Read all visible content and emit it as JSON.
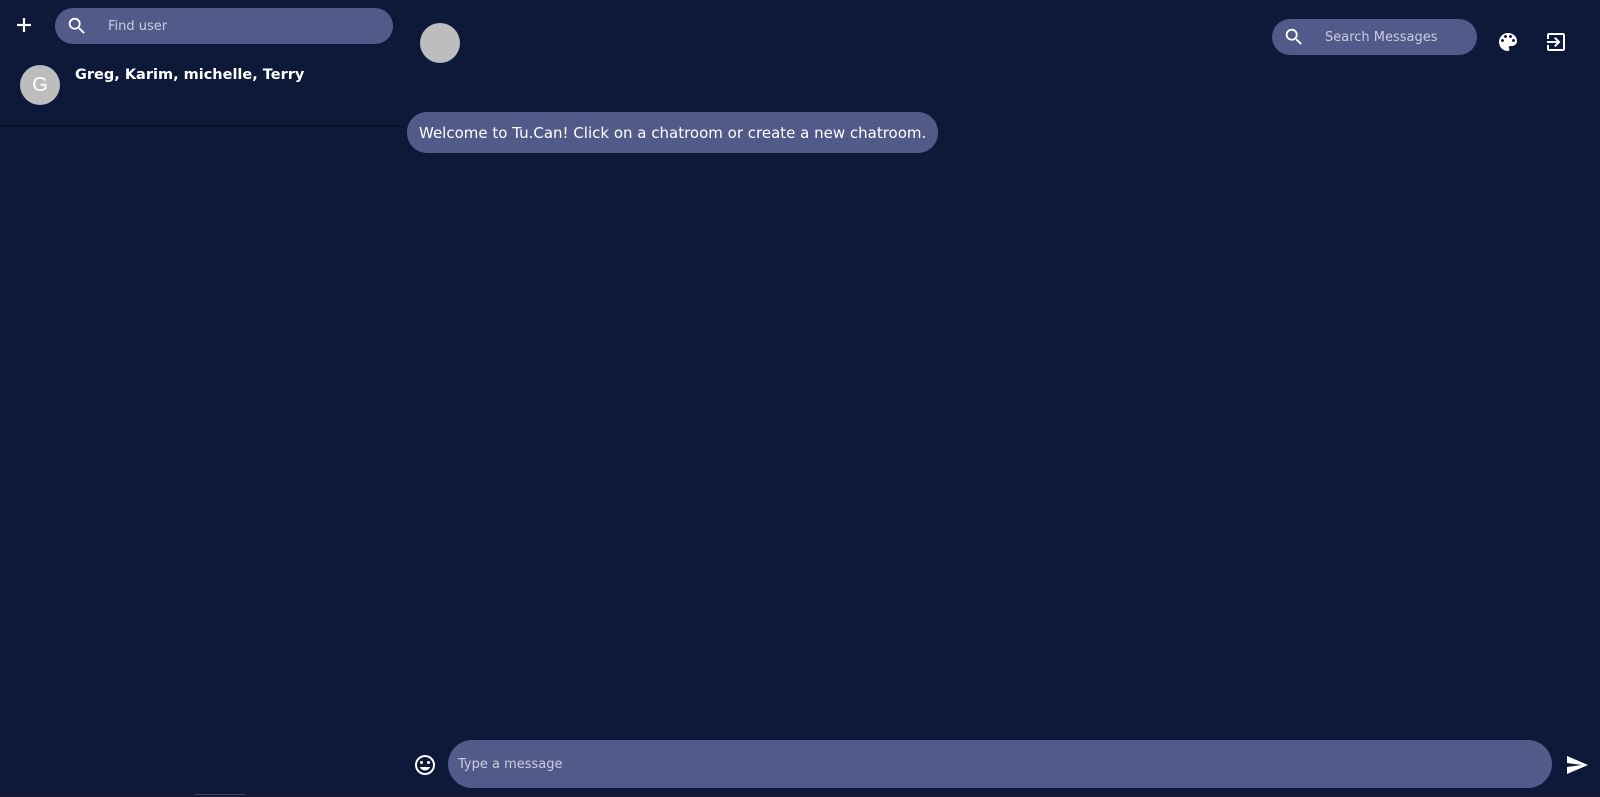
{
  "sidebar": {
    "find_user_placeholder": "Find user",
    "chatrooms": [
      {
        "initial": "G",
        "name": "Greg, Karim, michelle, Terry"
      }
    ]
  },
  "header": {
    "search_placeholder": "Search Messages"
  },
  "messages": {
    "welcome": "Welcome to Tu.Can! Click on a chatroom or create a new chatroom."
  },
  "composer": {
    "placeholder": "Type a message"
  },
  "icons": {
    "new_chat": "plus-icon",
    "search": "search-icon",
    "theme": "palette-icon",
    "logout": "exit-icon",
    "emoji": "smiley-icon",
    "send": "send-icon"
  },
  "colors": {
    "background": "#0e193a",
    "accent": "#525a8a",
    "avatar": "#bdbdbd",
    "text": "#ffffff"
  }
}
